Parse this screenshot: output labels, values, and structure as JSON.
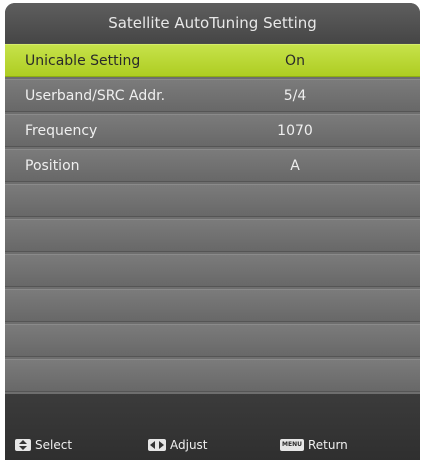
{
  "title": "Satellite AutoTuning Setting",
  "rows": [
    {
      "label": "Unicable Setting",
      "value": "On",
      "selected": true
    },
    {
      "label": "Userband/SRC Addr.",
      "value": "5/4",
      "selected": false
    },
    {
      "label": "Frequency",
      "value": "1070",
      "selected": false
    },
    {
      "label": "Position",
      "value": "A",
      "selected": false
    }
  ],
  "footer": {
    "select_label": "Select",
    "adjust_label": "Adjust",
    "return_label": "Return",
    "menu_key_label": "MENU"
  },
  "colors": {
    "highlight": "#b8d62e",
    "row": "#707070",
    "background": "#3e3e3e"
  }
}
